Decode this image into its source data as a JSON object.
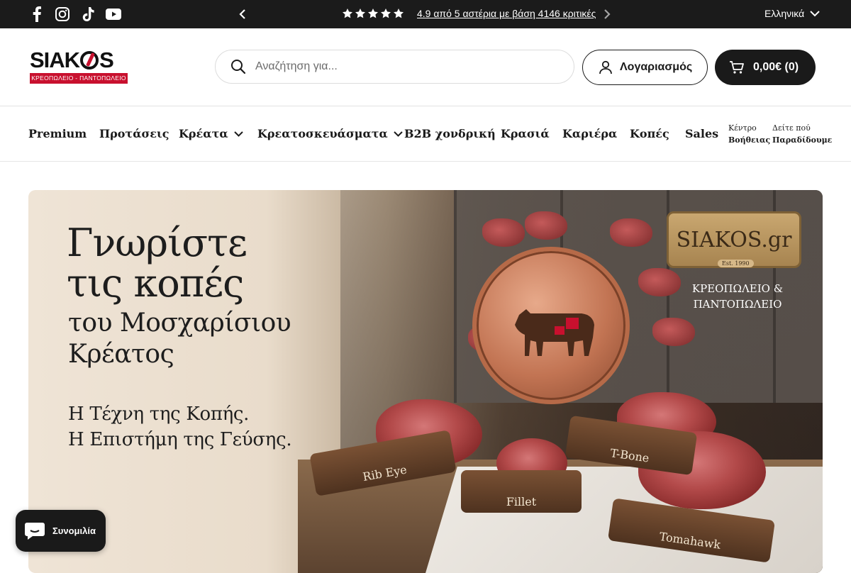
{
  "topbar": {
    "social": [
      {
        "icon": "facebook-icon"
      },
      {
        "icon": "instagram-icon"
      },
      {
        "icon": "tiktok-icon"
      },
      {
        "icon": "youtube-icon"
      }
    ],
    "announcement": "4.9 από 5 αστέρια με βάση 4146 κριτικές",
    "rating_stars": 5,
    "language": "Ελληνικά"
  },
  "header": {
    "logo_text_left": "SIAK",
    "logo_text_right": "S",
    "logo_subtitle": "ΚΡΕΟΠΩΛΕΙΟ - ΠΑΝΤΟΠΩΛΕΙΟ",
    "search_placeholder": "Αναζήτηση για...",
    "account_label": "Λογαριασμός",
    "cart_label": "0,00€ (0)"
  },
  "nav": {
    "items": [
      {
        "label": "Premium",
        "dropdown": false
      },
      {
        "label": "Προτάσεις",
        "dropdown": false
      },
      {
        "label": "Κρέατα",
        "dropdown": true
      },
      {
        "label": "Κρεατοσκευάσματα",
        "dropdown": true
      },
      {
        "label": "B2B χονδρική",
        "dropdown": false
      },
      {
        "label": "Κρασιά",
        "dropdown": false
      },
      {
        "label": "Καριέρα",
        "dropdown": false
      },
      {
        "label": "Κοπές",
        "dropdown": false
      },
      {
        "label": "Sales",
        "dropdown": false
      }
    ],
    "help_top": "Κέντρο",
    "help_bottom": "Βοήθειας",
    "delivery_top": "Δείτε πού",
    "delivery_bottom": "Παραδίδουμε"
  },
  "hero": {
    "title_line1": "Γνωρίστε",
    "title_line2": "τις κοπές",
    "subtitle_line1": "του Μοσχαρίσιου",
    "subtitle_line2": "Κρέατος",
    "tagline_line1": "Η Τέχνη της Κοπής.",
    "tagline_line2": "Η Επιστήμη της Γεύσης.",
    "plaque_brand": "SIAKOS.gr",
    "plaque_est": "Est. 1990",
    "plaque_sub_line1": "ΚΡΕΟΠΩΛΕΙΟ &",
    "plaque_sub_line2": "ΠΑΝΤΟΠΩΛΕΙΟ",
    "cuts": [
      "Rib Eye",
      "Fillet",
      "T-Bone",
      "Tomahawk"
    ]
  },
  "chat": {
    "label": "Συνομιλία"
  },
  "colors": {
    "brand_red": "#c8102e",
    "dark": "#1a1a1a"
  }
}
